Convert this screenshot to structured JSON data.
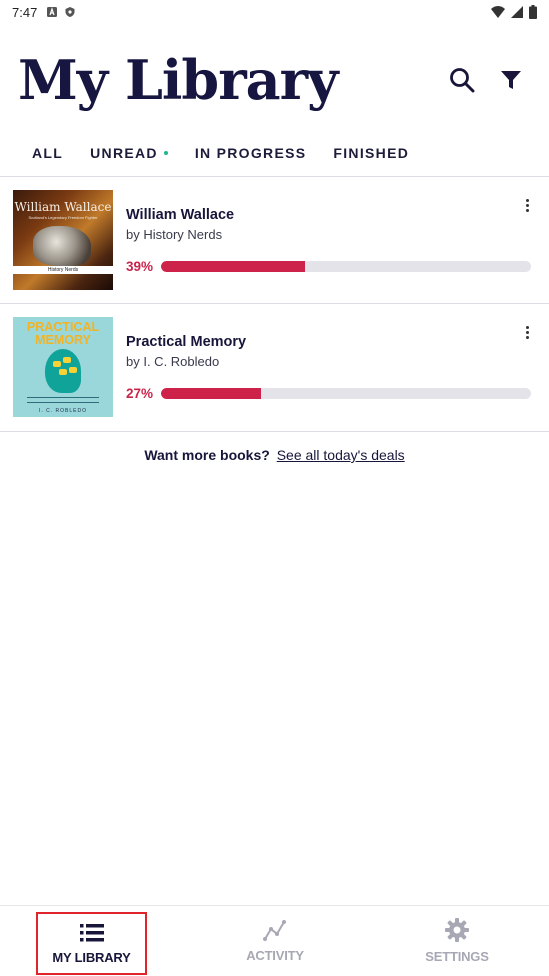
{
  "status_bar": {
    "time": "7:47"
  },
  "header": {
    "title": "My Library"
  },
  "tabs": [
    {
      "label": "ALL"
    },
    {
      "label": "UNREAD"
    },
    {
      "label": "IN PROGRESS"
    },
    {
      "label": "FINISHED"
    }
  ],
  "books": [
    {
      "title": "William Wallace",
      "author": "by History Nerds",
      "percent_label": "39%",
      "progress": 0.39,
      "cover": {
        "title": "William Wallace",
        "subtitle": "Scotland's Legendary Freedom Fighter",
        "band": "History Nerds"
      }
    },
    {
      "title": "Practical Memory",
      "author": "by I. C. Robledo",
      "percent_label": "27%",
      "progress": 0.27,
      "cover": {
        "title": "PRACTICAL MEMORY",
        "author": "I. C. ROBLEDO"
      }
    }
  ],
  "deals": {
    "prompt": "Want more books?",
    "link": "See all today's deals"
  },
  "bottom_nav": [
    {
      "label": "MY LIBRARY",
      "icon": "list-icon",
      "active": true
    },
    {
      "label": "ACTIVITY",
      "icon": "activity-icon",
      "active": false
    },
    {
      "label": "SETTINGS",
      "icon": "gear-icon",
      "active": false
    }
  ],
  "colors": {
    "accent": "#cd234b",
    "navy": "#17163a",
    "unread_dot": "#1db88e",
    "track": "#e4e3ea"
  }
}
